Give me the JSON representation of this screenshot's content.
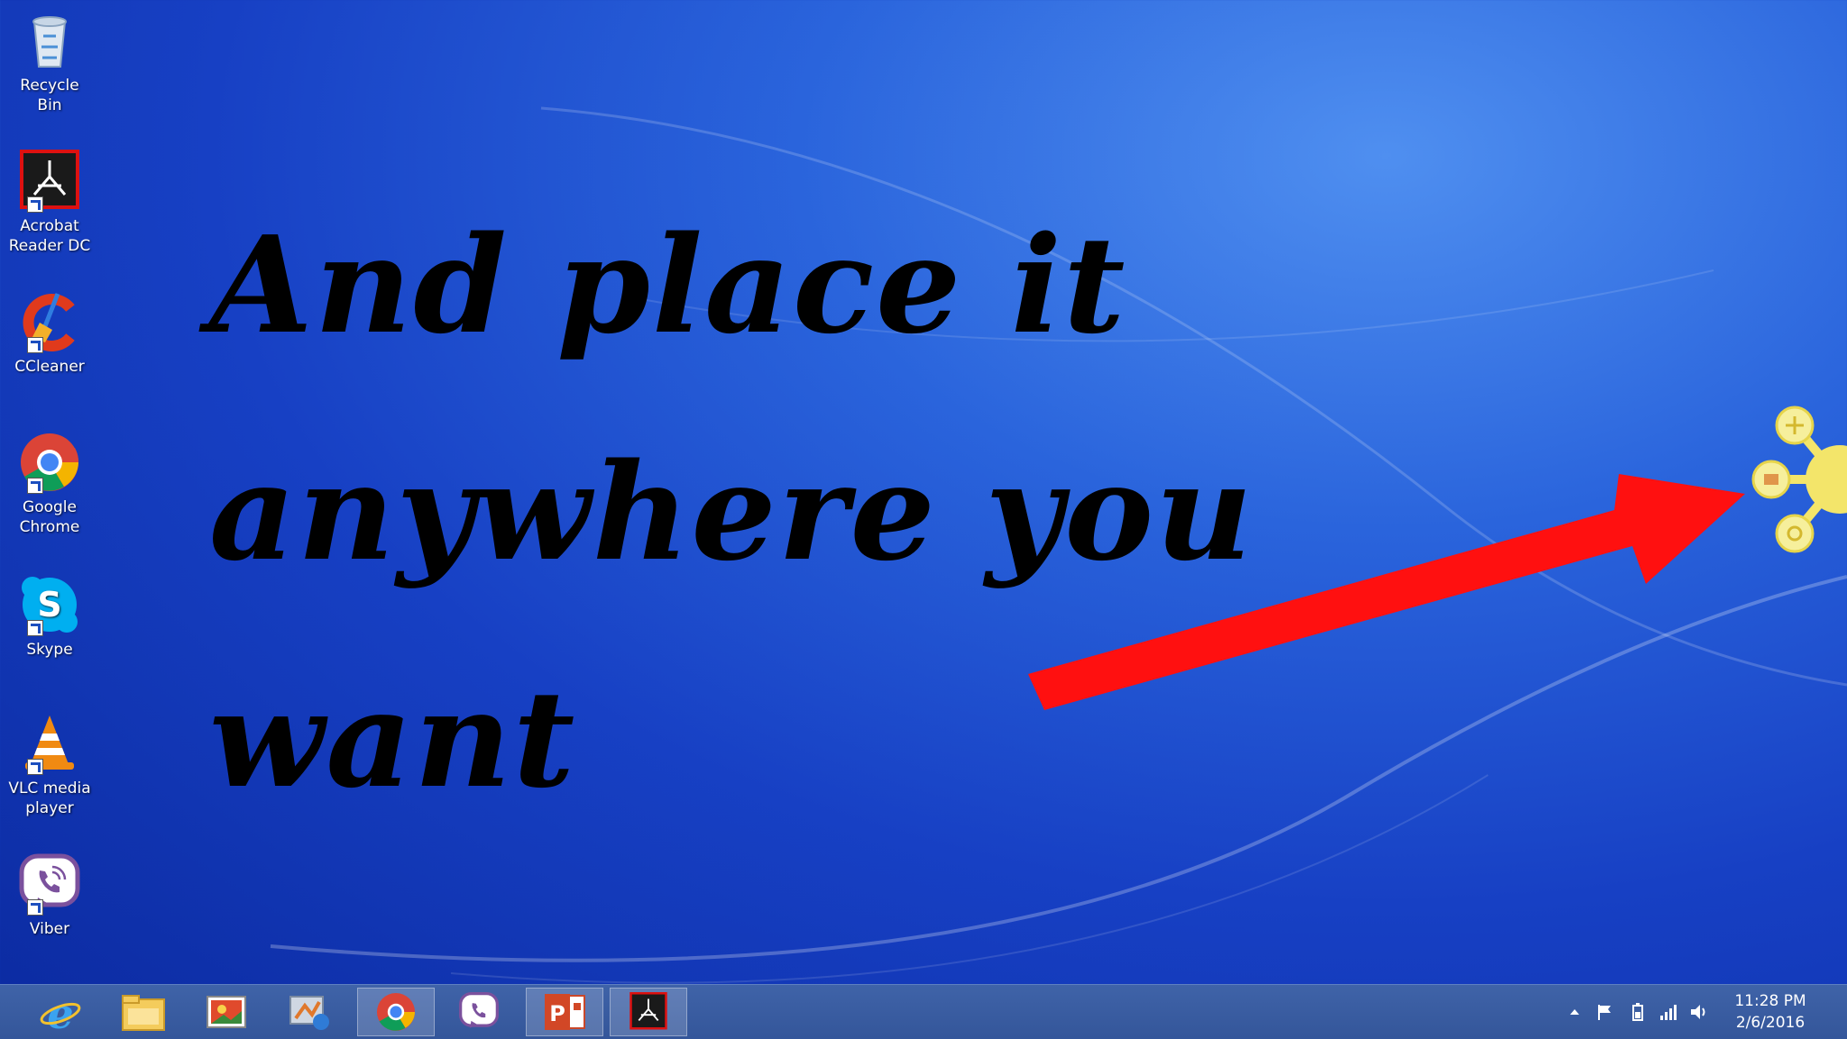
{
  "desktop": {
    "icons": [
      {
        "label": "Recycle Bin",
        "icon": "recycle-bin-icon"
      },
      {
        "label": "Acrobat Reader DC",
        "icon": "acrobat-icon"
      },
      {
        "label": "CCleaner",
        "icon": "ccleaner-icon"
      },
      {
        "label": "Google Chrome",
        "icon": "chrome-icon"
      },
      {
        "label": "Skype",
        "icon": "skype-icon"
      },
      {
        "label": "VLC media player",
        "icon": "vlc-icon"
      },
      {
        "label": "Viber",
        "icon": "viber-icon"
      }
    ]
  },
  "overlay": {
    "caption_line1": "And place it",
    "caption_line2": "anywhere you",
    "caption_line3": "want",
    "arrow_color": "#ff1010"
  },
  "taskbar": {
    "pinned": [
      {
        "icon": "internet-explorer-icon",
        "active": false
      },
      {
        "icon": "file-explorer-icon",
        "active": false
      },
      {
        "icon": "photos-icon",
        "active": false
      },
      {
        "icon": "media-center-icon",
        "active": false
      },
      {
        "icon": "chrome-icon",
        "active": true
      },
      {
        "icon": "viber-icon",
        "active": false
      },
      {
        "icon": "powerpoint-icon",
        "active": true
      },
      {
        "icon": "acrobat-icon",
        "active": true
      }
    ],
    "tray": {
      "time": "11:28 PM",
      "date": "2/6/2016"
    }
  },
  "colors": {
    "taskbar": "#3a5da2",
    "wallpaper": "#1a46c8"
  }
}
